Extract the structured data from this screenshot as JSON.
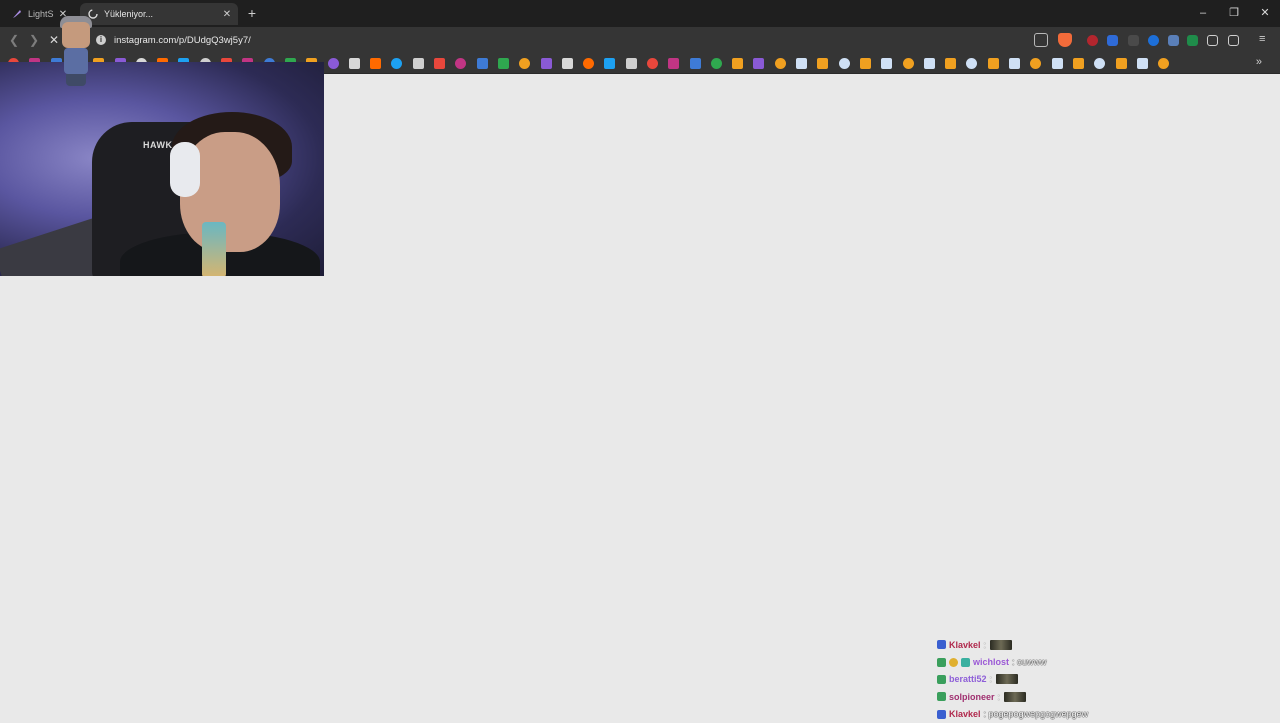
{
  "browser": {
    "tabs": [
      {
        "title": "LightS",
        "active": false
      },
      {
        "title": "Yükleniyor...",
        "active": true
      }
    ],
    "url": "instagram.com/p/DUdgQ3wj5y7/",
    "accent": "#e0e0e0"
  },
  "window_controls": {
    "minimize": "–",
    "maximize": "❐",
    "close": "✕"
  },
  "bookmarks": {
    "overflow": "»"
  },
  "webcam": {
    "chair_brand": "HAWK"
  },
  "chat": {
    "messages": [
      {
        "user": "Klavkel",
        "color": "#b0284c",
        "message": ":",
        "emote": true
      },
      {
        "user": "wichlost",
        "color": "#9b59d6",
        "message": ": ouwww",
        "emote": false
      },
      {
        "user": "beratti52",
        "color": "#8e5fd8",
        "message": ":",
        "emote": true
      },
      {
        "user": "solpioneer",
        "color": "#a03070",
        "message": ":",
        "emote": true
      },
      {
        "user": "Klavkel",
        "color": "#b0284c",
        "message": ": pogepogwepgogwepgew",
        "emote": false
      }
    ]
  }
}
